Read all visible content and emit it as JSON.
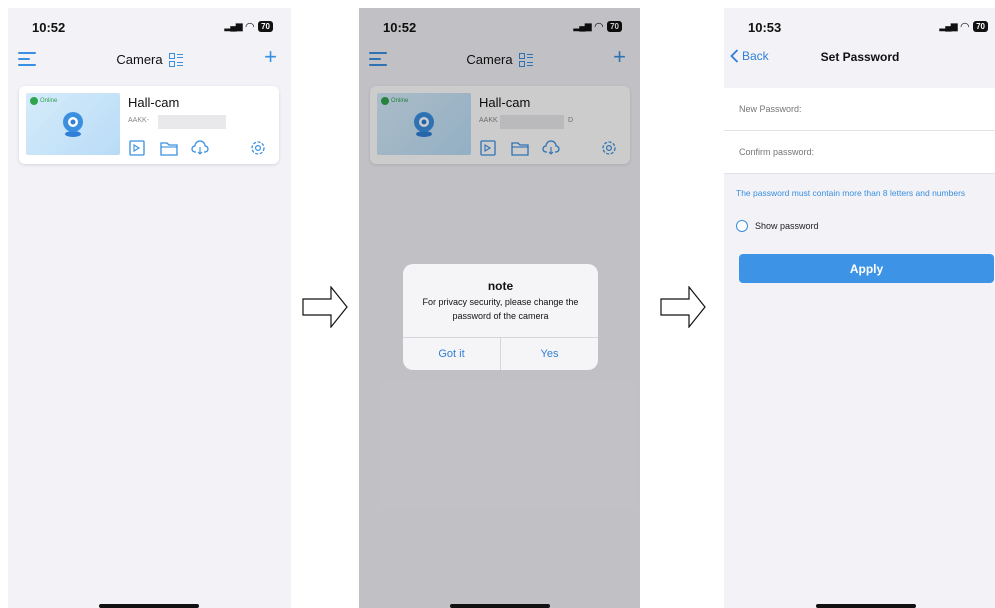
{
  "screen1": {
    "status_time": "10:52",
    "battery": "70",
    "nav_title": "Camera",
    "camera": {
      "name": "Hall-cam",
      "id_prefix": "AAKK-",
      "status": "Online"
    }
  },
  "screen2": {
    "status_time": "10:52",
    "battery": "70",
    "nav_title": "Camera",
    "camera": {
      "name": "Hall-cam",
      "id_prefix": "AAKK",
      "id_suffix": "D",
      "status": "Online"
    },
    "dialog": {
      "title": "note",
      "message": "For privacy security, please change the password of the camera",
      "buttons": [
        "Got it",
        "Yes"
      ]
    }
  },
  "screen3": {
    "status_time": "10:53",
    "battery": "70",
    "back_label": "Back",
    "title": "Set Password",
    "fields": [
      {
        "placeholder": "New Password:"
      },
      {
        "placeholder": "Confirm password:"
      }
    ],
    "hint": "The password must contain more than 8 letters and numbers",
    "show_password_label": "Show password",
    "apply_label": "Apply"
  },
  "colors": {
    "accent": "#3a8fe0",
    "button": "#3d94e6",
    "online": "#2ea44f"
  }
}
